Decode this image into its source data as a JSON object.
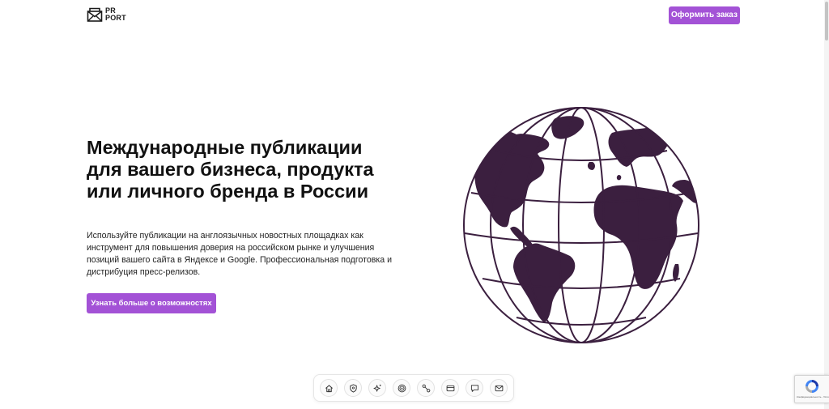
{
  "header": {
    "logo_line1": "PR",
    "logo_line2": "PORT",
    "order_button_label": "Оформить заказ"
  },
  "hero": {
    "title": "Международные публикации для вашего бизнеса, продукта или личного бренда в России",
    "description": "Используйте публикации на англоязычных новостных площадках как инструмент для повышения доверия на российском рынке и улучшения позиций вашего сайта в Яндексе и Google. Профессиональная подготовка и дистрибуция пресс-релизов.",
    "cta_label": "Узнать больше о возможностях"
  },
  "dock": {
    "items": [
      {
        "icon": "home-icon"
      },
      {
        "icon": "shield-icon"
      },
      {
        "icon": "sparkles-icon"
      },
      {
        "icon": "target-icon"
      },
      {
        "icon": "route-icon"
      },
      {
        "icon": "credit-card-icon"
      },
      {
        "icon": "chat-icon"
      },
      {
        "icon": "mail-icon"
      }
    ]
  },
  "recaptcha": {
    "text": "Конфиденциальность - Условия использования"
  },
  "colors": {
    "accent": "#a352d6",
    "globe": "#3b1f3f",
    "text": "#111111"
  }
}
